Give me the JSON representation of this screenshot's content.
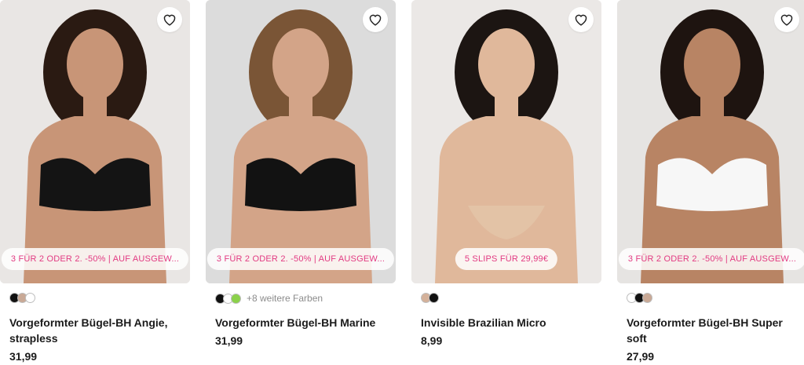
{
  "products": [
    {
      "name": "Vorgeformter Bügel-BH Angie, strapless",
      "price": "31,99",
      "promo": "3 FÜR 2 ODER 2. -50% | AUF AUSGEW...",
      "swatches": [
        "#111111",
        "#c9a996",
        "#ffffff"
      ],
      "more_colors": "",
      "garment_color": "#141414",
      "skin_color": "#c89577",
      "hair_color": "#2a1a12",
      "bg_color": "#e9e6e4"
    },
    {
      "name": "Vorgeformter Bügel-BH Marine",
      "price": "31,99",
      "promo": "3 FÜR 2 ODER 2. -50% | AUF AUSGEW...",
      "swatches": [
        "#111111",
        "#ffffff",
        "#8bd14a"
      ],
      "more_colors": "+8 weitere Farben",
      "garment_color": "#121212",
      "skin_color": "#d3a488",
      "hair_color": "#7a5536",
      "bg_color": "#dcdcdc"
    },
    {
      "name": "Invisible Brazilian Micro",
      "price": "8,99",
      "promo": "5 SLIPS FÜR 29,99€",
      "swatches": [
        "#d4b19a",
        "#111111"
      ],
      "more_colors": "",
      "garment_color": "#e3c3a6",
      "skin_color": "#e0b89b",
      "hair_color": "#1c1512",
      "bg_color": "#ebe8e6"
    },
    {
      "name": "Vorgeformter Bügel-BH Super soft",
      "price": "27,99",
      "promo": "3 FÜR 2 ODER 2. -50% | AUF AUSGEW...",
      "swatches": [
        "#ffffff",
        "#111111",
        "#c9a996"
      ],
      "more_colors": "",
      "garment_color": "#f7f7f7",
      "skin_color": "#b88464",
      "hair_color": "#1e1410",
      "bg_color": "#e6e4e2"
    }
  ]
}
